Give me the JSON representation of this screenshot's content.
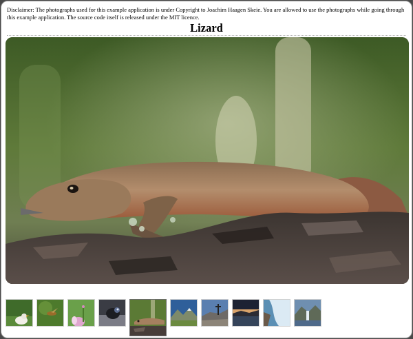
{
  "page": {
    "disclaimer": "Disclaimer: The photographs used for this example application is under Copyright to Joachim Haagen Skeie. You are allowed to use the photographs while going through this example application. The source code itself is released under the MIT licence.",
    "photo_title": "Lizard"
  },
  "gallery": {
    "main_photo_subject": "lizard",
    "selected_index": 4,
    "thumbnails": [
      {
        "subject": "bird"
      },
      {
        "subject": "insect"
      },
      {
        "subject": "flower"
      },
      {
        "subject": "beetle"
      },
      {
        "subject": "lizard"
      },
      {
        "subject": "mountain-landscape"
      },
      {
        "subject": "summit-cross"
      },
      {
        "subject": "sunset-lake"
      },
      {
        "subject": "waterfall-stream"
      },
      {
        "subject": "mountain-waterfall"
      }
    ]
  },
  "colors": {
    "window_background": "#ffffff",
    "desktop_background": "#4a4a4a",
    "selected_thumb_border": "#6d6d6d"
  }
}
